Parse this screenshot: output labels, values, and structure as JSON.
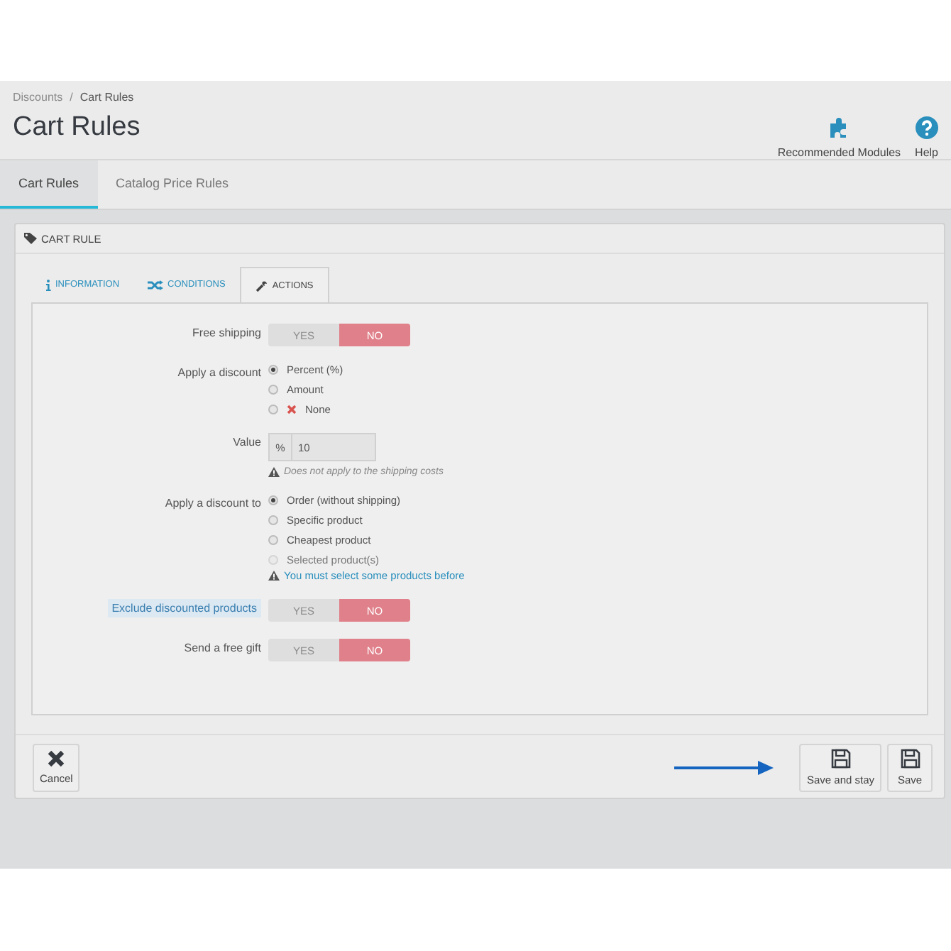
{
  "breadcrumb": {
    "items": [
      "Discounts",
      "Cart Rules"
    ],
    "separator": "/"
  },
  "page_title": "Cart Rules",
  "toolbar": [
    {
      "label": "Recommended Modules"
    },
    {
      "label": "Help"
    }
  ],
  "tabs": [
    {
      "label": "Cart Rules",
      "selected": true
    },
    {
      "label": "Catalog Price Rules",
      "selected": false
    }
  ],
  "panel": {
    "title": "CART RULE",
    "tabs": [
      {
        "label": "INFORMATION",
        "selected": false
      },
      {
        "label": "CONDITIONS",
        "selected": false
      },
      {
        "label": "ACTIONS",
        "selected": true
      }
    ],
    "fields": [
      {
        "kind": "switch",
        "label": "Free shipping",
        "highlighted": false,
        "options": [
          "YES",
          "NO"
        ],
        "on": false
      },
      {
        "kind": "radio",
        "label": "Apply a discount",
        "highlighted": false,
        "options": [
          {
            "label": "Percent (%)",
            "selected": true,
            "disabled": false
          },
          {
            "label": "Amount",
            "selected": false,
            "disabled": false
          },
          {
            "label": "None",
            "selected": false,
            "disabled": false
          }
        ]
      },
      {
        "kind": "input",
        "label": "Value",
        "highlighted": false,
        "prefix": "%",
        "value": "10",
        "hint": "Does not apply to the shipping costs"
      },
      {
        "kind": "radio",
        "label": "Apply a discount to",
        "highlighted": false,
        "options": [
          {
            "label": "Order (without shipping)",
            "selected": true,
            "disabled": false
          },
          {
            "label": "Specific product",
            "selected": false,
            "disabled": false
          },
          {
            "label": "Cheapest product",
            "selected": false,
            "disabled": false
          },
          {
            "label": "Selected product(s)",
            "selected": false,
            "disabled": true
          }
        ],
        "warning": "You must select some products before"
      },
      {
        "kind": "switch",
        "label": "Exclude discounted products",
        "highlighted": true,
        "options": [
          "YES",
          "NO"
        ],
        "on": false
      },
      {
        "kind": "switch",
        "label": "Send a free gift",
        "highlighted": false,
        "options": [
          "YES",
          "NO"
        ],
        "on": false
      }
    ]
  },
  "footer": {
    "buttons": [
      {
        "label": "Cancel"
      },
      {
        "label": "Save and stay"
      },
      {
        "label": "Save"
      }
    ]
  }
}
